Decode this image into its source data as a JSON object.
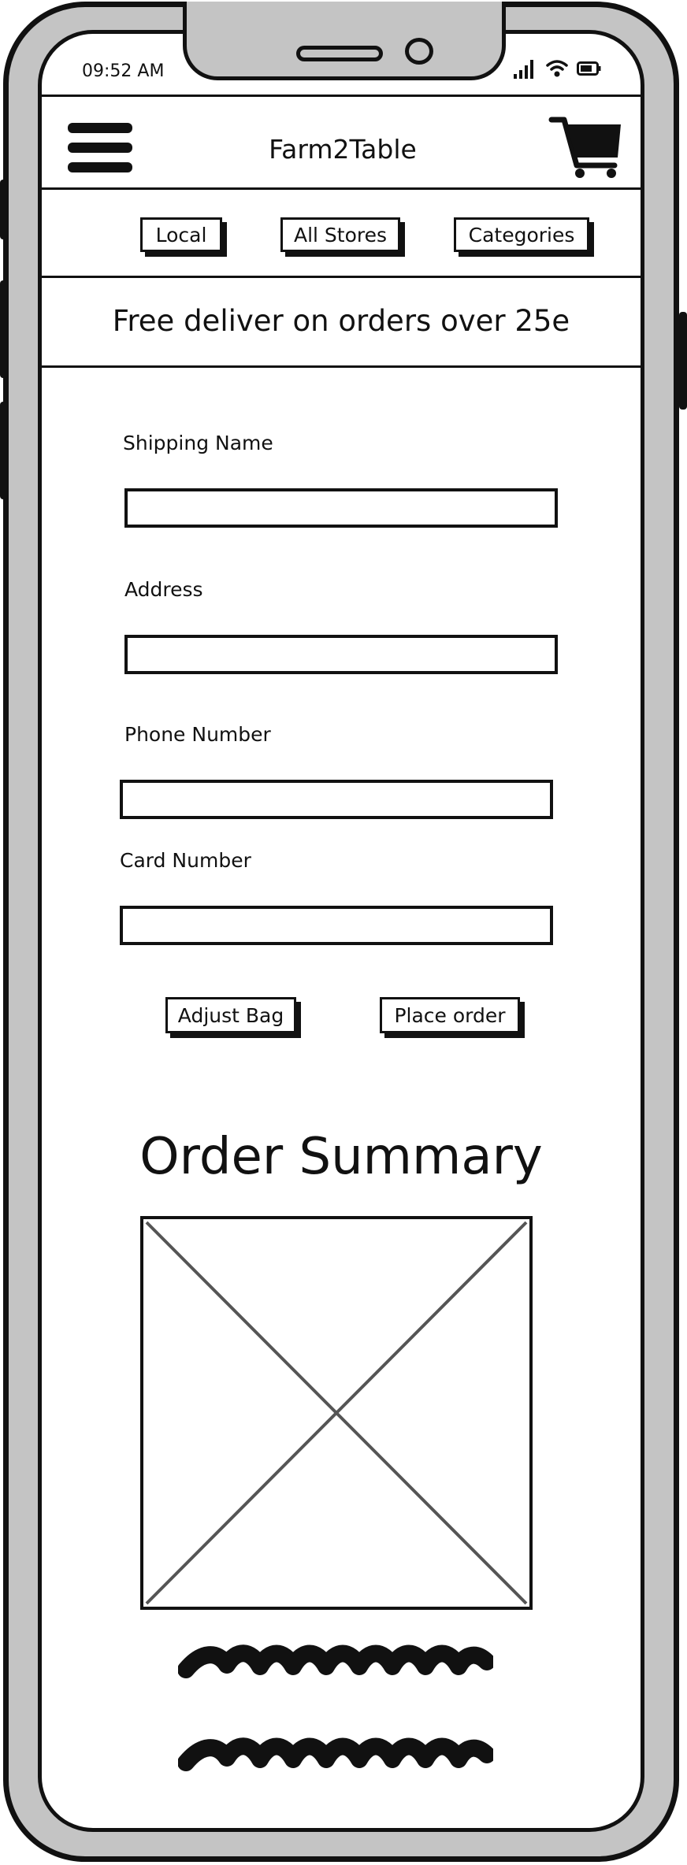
{
  "status_bar": {
    "time": "09:52 AM",
    "icons": [
      "signal-icon",
      "wifi-icon",
      "battery-icon"
    ]
  },
  "header": {
    "menu_icon": "hamburger-menu-icon",
    "title": "Farm2Table",
    "cart_icon": "shopping-cart-icon"
  },
  "nav": {
    "tabs": [
      {
        "label": "Local"
      },
      {
        "label": "All Stores"
      },
      {
        "label": "Categories"
      }
    ]
  },
  "banner": {
    "text": "Free deliver on orders over 25e"
  },
  "form": {
    "fields": [
      {
        "label": "Shipping Name",
        "value": "",
        "placeholder": ""
      },
      {
        "label": "Address",
        "value": "",
        "placeholder": ""
      },
      {
        "label": "Phone Number",
        "value": "",
        "placeholder": ""
      },
      {
        "label": "Card Number",
        "value": "",
        "placeholder": ""
      }
    ],
    "adjust_label": "Adjust Bag",
    "place_order_label": "Place order"
  },
  "summary": {
    "title": "Order Summary",
    "image": "image-placeholder"
  }
}
